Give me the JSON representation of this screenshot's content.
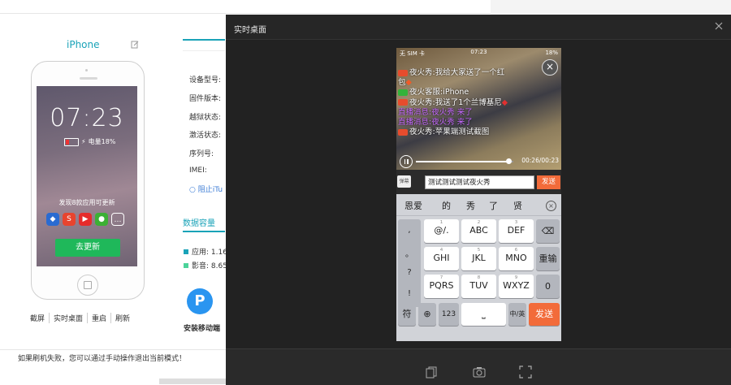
{
  "device": {
    "name": "iPhone"
  },
  "phone_screen": {
    "time": "07:23",
    "battery": "电量18%",
    "update_text": "发现8款应用可更新",
    "update_button": "去更新"
  },
  "phone_actions": [
    "截屏",
    "实时桌面",
    "重启",
    "刷新"
  ],
  "device_info": {
    "labels": [
      "设备型号:",
      "固件版本:",
      "越狱状态:",
      "激活状态:",
      "序列号:",
      "IMEI:"
    ],
    "link": "阻止iTu"
  },
  "storage": {
    "title": "数据容量",
    "rows": [
      {
        "label": "应用: 1.16",
        "color": "#1aa3b8"
      },
      {
        "label": "影音: 8.65",
        "color": "#4cd39a"
      }
    ]
  },
  "install_app": {
    "label": "安装移动端",
    "icon_letter": "P"
  },
  "bottom_message": "如果刷机失败，您可以通过手动操作退出当前模式！",
  "overlay": {
    "title": "实时桌面",
    "status_bar": {
      "left": "无 SIM 卡 ",
      "time": "07:23",
      "right": "18%"
    },
    "chat": [
      {
        "tag": "orange",
        "text": "夜火秀:我给大家送了一个红"
      },
      {
        "tag": "none",
        "text": "包"
      },
      {
        "tag": "green",
        "text": "夜火客服:iPhone"
      },
      {
        "tag": "orange",
        "text": "夜火秀:我送了1个兰博基尼"
      },
      {
        "tag": "none",
        "text": "直播消息:夜火秀 来了",
        "purple": true
      },
      {
        "tag": "none",
        "text": "直播消息:夜火秀 来了",
        "purple": true
      },
      {
        "tag": "orange",
        "text": "夜火秀:苹果端测试截图"
      }
    ],
    "video_time": "00:26/00:23",
    "video_progress": 0.95,
    "danmu_label": "弹幕",
    "input_value": "测试测试测试夜火秀",
    "send_label": "发送",
    "candidates": [
      "恩爱",
      "的",
      "秀",
      "了",
      "贤"
    ],
    "left_keys": [
      ",",
      "。",
      "?",
      "!"
    ],
    "keys": [
      {
        "sub": "1",
        "main": "@/."
      },
      {
        "sub": "2",
        "main": "ABC"
      },
      {
        "sub": "3",
        "main": "DEF"
      },
      {
        "sub": "4",
        "main": "GHI"
      },
      {
        "sub": "5",
        "main": "JKL"
      },
      {
        "sub": "6",
        "main": "MNO"
      },
      {
        "sub": "7",
        "main": "PQRS"
      },
      {
        "sub": "8",
        "main": "TUV"
      },
      {
        "sub": "9",
        "main": "WXYZ"
      }
    ],
    "reinput_label": "重输",
    "zero_label": "0",
    "symbol_label": "符",
    "num_label": "123",
    "lang_label": "中/英",
    "send_key_label": "发送"
  }
}
